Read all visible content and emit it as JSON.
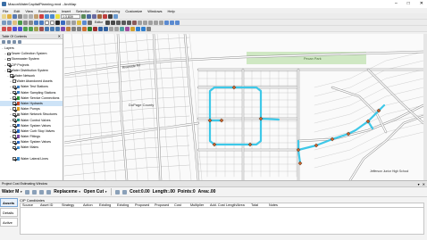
{
  "window": {
    "title": "MaconWaterCapitalPlanning.mxd - ArcMap",
    "controls": [
      "–",
      "□",
      "✕"
    ]
  },
  "menu": [
    "File",
    "Edit",
    "View",
    "Bookmarks",
    "Insert",
    "Selection",
    "Geoprocessing",
    "Customize",
    "Windows",
    "Help"
  ],
  "toolbar": {
    "scale": "1:3,839",
    "editor_label": "Editor"
  },
  "toc": {
    "title": "Table Of Contents",
    "close": "✕",
    "rows": [
      {
        "label": "Layers",
        "level": 0,
        "exp": "−",
        "checked": null,
        "sym": ""
      },
      {
        "label": "Sewer Collection System",
        "level": 1,
        "exp": "+",
        "checked": false,
        "sym": ""
      },
      {
        "label": "Stormwater System",
        "level": 1,
        "exp": "+",
        "checked": false,
        "sym": ""
      },
      {
        "label": "CIP Projects",
        "level": 1,
        "exp": "+",
        "checked": true,
        "sym": ""
      },
      {
        "label": "Water Distribution System",
        "level": 1,
        "exp": "−",
        "checked": true,
        "sym": ""
      },
      {
        "label": "Water Network",
        "level": 2,
        "exp": "−",
        "checked": true,
        "sym": ""
      },
      {
        "label": "Water Abandoned Assets",
        "level": 3,
        "exp": "+",
        "checked": false,
        "sym": ""
      },
      {
        "label": "Water Test Stations",
        "level": 3,
        "exp": "+",
        "checked": true,
        "sym": "#3d7fc4"
      },
      {
        "label": "Water Sampling Stations",
        "level": 3,
        "exp": "+",
        "checked": true,
        "sym": "#3d7fc4"
      },
      {
        "label": "Water Service Connections",
        "level": 3,
        "exp": "+",
        "checked": true,
        "sym": "#2c9a3c"
      },
      {
        "label": "Water Hydrants",
        "level": 3,
        "exp": "",
        "checked": true,
        "sym": "#d04a2a"
      },
      {
        "label": "Water Pumps",
        "level": 3,
        "exp": "+",
        "checked": true,
        "sym": "#e0a020"
      },
      {
        "label": "Water Network Structures",
        "level": 3,
        "exp": "+",
        "checked": true,
        "sym": "#7a7a7a"
      },
      {
        "label": "Water Control Valves",
        "level": 3,
        "exp": "+",
        "checked": true,
        "sym": "#2a9a8a"
      },
      {
        "label": "Water System Valves",
        "level": 3,
        "exp": "+",
        "checked": true,
        "sym": "#2a6ac4"
      },
      {
        "label": "Water Curb Stop Valves",
        "level": 3,
        "exp": "+",
        "checked": true,
        "sym": "#2a6ac4"
      },
      {
        "label": "Water Fittings",
        "level": 3,
        "exp": "+",
        "checked": true,
        "sym": "#7a4aa8"
      },
      {
        "label": "Water System Valves",
        "level": 3,
        "exp": "+",
        "checked": true,
        "sym": "#2a6ac4"
      },
      {
        "label": "Water Mains",
        "level": 3,
        "exp": "",
        "checked": true,
        "sym": "#3d8fd4"
      },
      {
        "label": "",
        "level": 3,
        "exp": "",
        "checked": null,
        "sym": ""
      },
      {
        "label": "Water Lateral Lines",
        "level": 3,
        "exp": "",
        "checked": true,
        "sym": "#3d8fd4"
      }
    ]
  },
  "map": {
    "labels": {
      "riverside": "Riverside Rd",
      "park": "Pecan Park",
      "dupage": "DuPage County",
      "school": "Jefferson Junior High School"
    },
    "colors": {
      "main": "#3ec8e8",
      "park": "#cfe8c3",
      "roads": "#8a8a8a",
      "parcels": "#b4b4b4",
      "valve": "#c8602a"
    }
  },
  "cip": {
    "window_title": "Project Cost Estimating Window",
    "window_controls": [
      "▾",
      "✕"
    ],
    "asset_select": "Water M",
    "action_select": "Replaceme",
    "method_select": "Open Cut",
    "cost_label": "Cost:",
    "cost_value": "0.00",
    "length_label": "Length:",
    "length_value": ".00",
    "points_label": "Points:",
    "points_value": "0",
    "area_label": "Area:",
    "area_value": ".00",
    "candidates_title": "CIP Candidates",
    "tabs": [
      "Assets",
      "Details",
      "Active"
    ],
    "columns": [
      "Source",
      "Asset ID",
      "Strategy",
      "Action",
      "Existing",
      "Existing",
      "Proposed",
      "Proposed",
      "Cost",
      "Multiplier",
      "Add. Cost",
      "Length/Area",
      "Total",
      "Notes"
    ]
  }
}
